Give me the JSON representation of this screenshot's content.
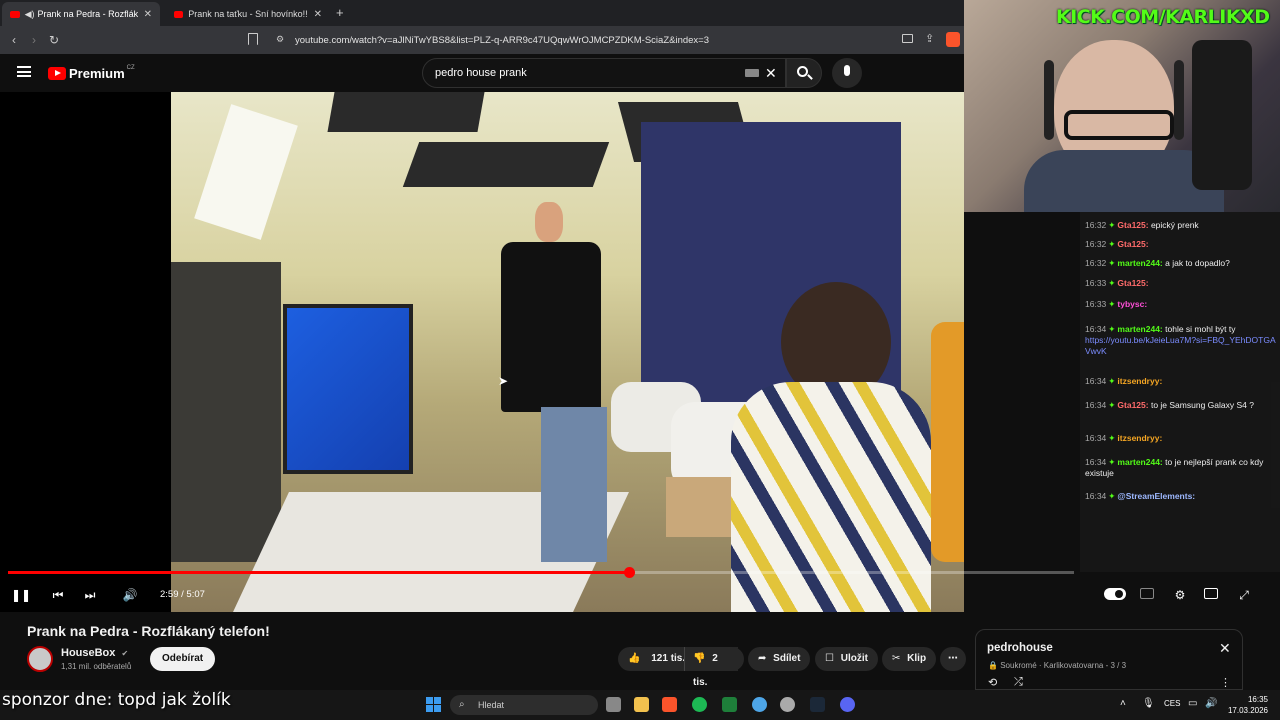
{
  "browser": {
    "tabs": [
      {
        "label": "Prank na Pedra - Rozflákaný t",
        "active": true
      },
      {
        "label": "Prank na taťku - Sní hovínko!! - YouT",
        "active": false
      }
    ],
    "new_tab": "+",
    "url": "youtube.com/watch?v=aJlNiTwYBS8&list=PLZ-q-ARR9c47UQqwWrOJMCPZDKM-SciaZ&index=3"
  },
  "youtube": {
    "logo_text": "Premium",
    "logo_region": "CZ",
    "search_value": "pedro house prank",
    "clear_icon": "✕"
  },
  "player": {
    "time": "2:59 / 5:07",
    "progress_fraction": 0.583
  },
  "video": {
    "title": "Prank na Pedra - Rozflákaný telefon!",
    "channel": "HouseBox",
    "verified": "✔",
    "subscribers": "1,31 mil. odběratelů",
    "subscribe_label": "Odebírat",
    "likes": "121 tis.",
    "dislikes": "2 tis.",
    "share_label": "Sdílet",
    "save_label": "Uložit",
    "clip_label": "Klip",
    "more_label": "⋯"
  },
  "playlist": {
    "title": "pedrohouse",
    "subtitle": "Soukromé · Karlikovatovarna - 3 / 3"
  },
  "stream": {
    "kick_url": "KICK.COM/KARLIKXD",
    "sponsor_text": "sponzor dne: topd jak žolík",
    "chat": [
      {
        "time": "16:32",
        "user": "Gta125",
        "color": "#ff6b6b",
        "text": "epický prenk"
      },
      {
        "time": "16:32",
        "user": "Gta125",
        "color": "#ff6b6b",
        "text": ""
      },
      {
        "time": "16:32",
        "user": "marten244",
        "color": "#53fc18",
        "text": "a jak to dopadlo?"
      },
      {
        "time": "16:33",
        "user": "Gta125",
        "color": "#ff6b6b",
        "text": ""
      },
      {
        "time": "16:33",
        "user": "tybysc",
        "color": "#ff4fd8",
        "text": ""
      },
      {
        "time": "16:34",
        "user": "marten244",
        "color": "#53fc18",
        "text": "tohle si mohl být ty",
        "link": "https://youtu.be/kJeieLua7M?si=FBQ_YEhDOTGAVwvK"
      },
      {
        "time": "16:34",
        "user": "itzsendryy",
        "color": "#f5a623",
        "text": ""
      },
      {
        "time": "16:34",
        "user": "Gta125",
        "color": "#ff6b6b",
        "text": "to je Samsung Galaxy S4 ?"
      },
      {
        "time": "16:34",
        "user": "itzsendryy",
        "color": "#f5a623",
        "text": ""
      },
      {
        "time": "16:34",
        "user": "marten244",
        "color": "#53fc18",
        "text": "to je nejlepší prank co kdy existuje"
      },
      {
        "time": "16:34",
        "user": "@StreamElements",
        "color": "#9db8ff",
        "text": ""
      }
    ]
  },
  "taskbar": {
    "search_placeholder": "Hledat",
    "lang": "CES",
    "time": "16:35",
    "date": "17.03.2026"
  }
}
